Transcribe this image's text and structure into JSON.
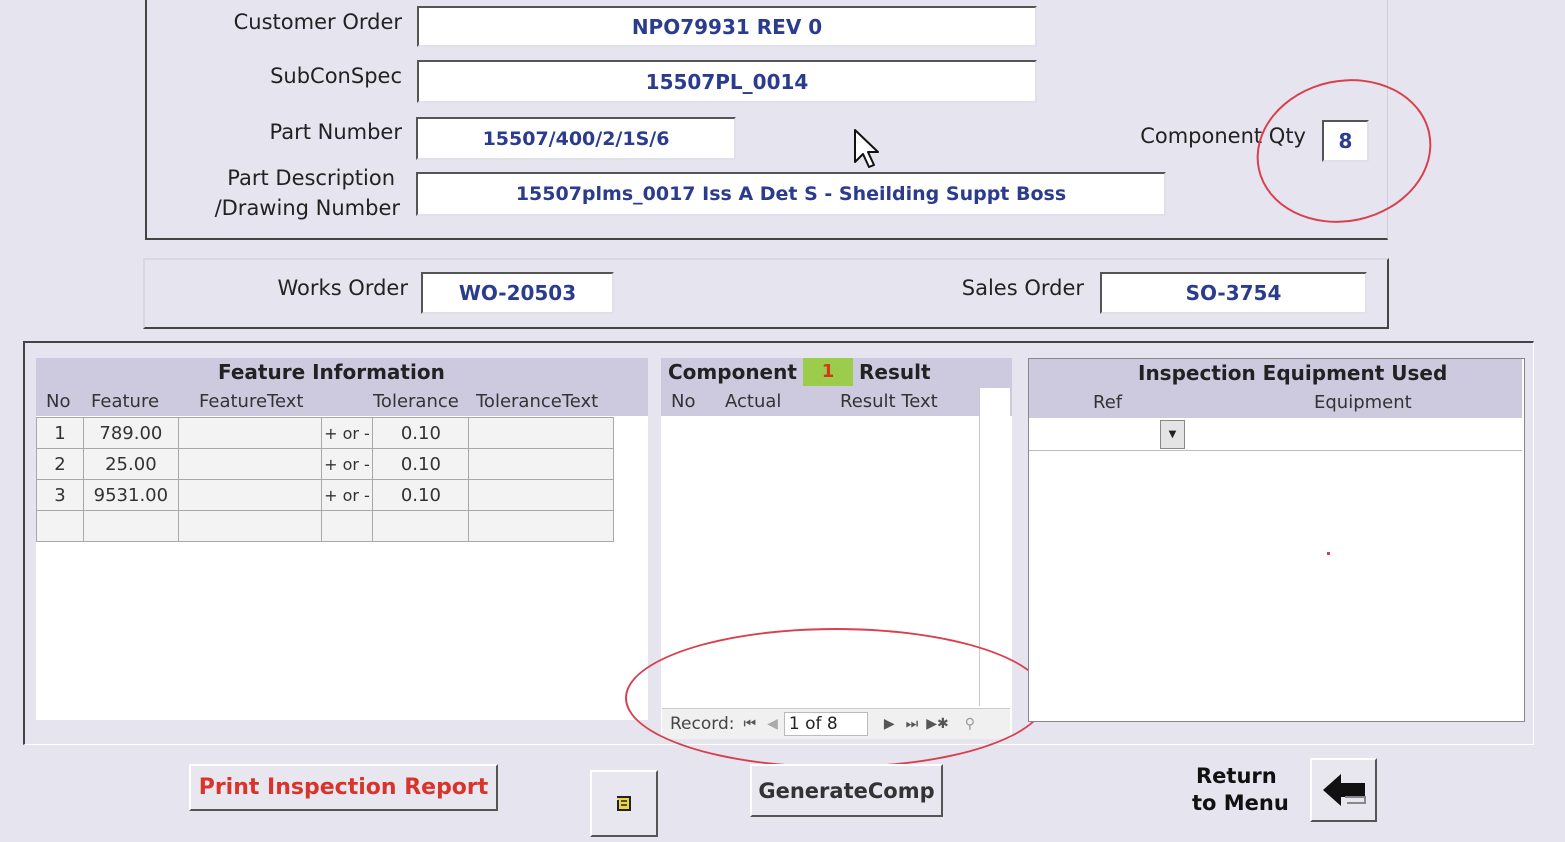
{
  "header": {
    "customer_order_label": "Customer Order",
    "customer_order_value": "NPO79931 REV 0",
    "subconspec_label": "SubConSpec",
    "subconspec_value": "15507PL_0014",
    "part_number_label": "Part Number",
    "part_number_value": "15507/400/2/1S/6",
    "part_desc_label_1": "Part Description",
    "part_desc_label_2": "/Drawing Number",
    "part_desc_value": "15507plms_0017 Iss A  Det S - Sheilding Suppt Boss",
    "component_qty_label": "Component Qty",
    "component_qty_value": "8"
  },
  "orders": {
    "works_order_label": "Works Order",
    "works_order_value": "WO-20503",
    "sales_order_label": "Sales Order",
    "sales_order_value": "SO-3754"
  },
  "features": {
    "title": "Feature Information",
    "columns": [
      "No",
      "Feature",
      "FeatureText",
      "Tolerance",
      "ToleranceText"
    ],
    "rows": [
      {
        "no": "1",
        "feature": "789.00",
        "feature_text": "",
        "pm": "+ or -",
        "tolerance": "0.10",
        "tolerance_text": ""
      },
      {
        "no": "2",
        "feature": "25.00",
        "feature_text": "",
        "pm": "+ or -",
        "tolerance": "0.10",
        "tolerance_text": ""
      },
      {
        "no": "3",
        "feature": "9531.00",
        "feature_text": "",
        "pm": "+ or -",
        "tolerance": "0.10",
        "tolerance_text": ""
      }
    ]
  },
  "component": {
    "title_left": "Component",
    "number": "1",
    "title_right": "Result",
    "columns": [
      "No",
      "Actual",
      "Result Text"
    ],
    "record_label": "Record:",
    "record_value": "1 of 8"
  },
  "equipment": {
    "title": "Inspection Equipment Used",
    "columns": [
      "Ref",
      "Equipment"
    ]
  },
  "buttons": {
    "print_report": "Print Inspection Report",
    "generate_comp": "GenerateComp",
    "return_label_1": "Return",
    "return_label_2": "to Menu"
  },
  "colors": {
    "background": "#e6e4ee",
    "field_text": "#2b3b8e",
    "header_band": "#cdcae0",
    "component_number_bg": "#9ccc4c",
    "component_number_text": "#d13a1a",
    "print_button_text": "#d9342b",
    "annotation": "#d9404e"
  }
}
